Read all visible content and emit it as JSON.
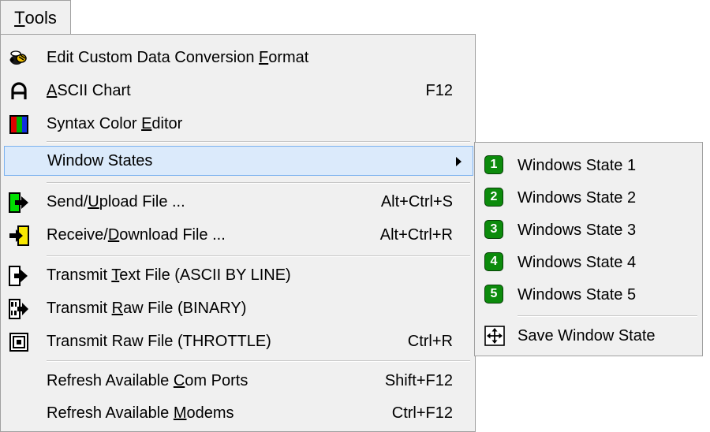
{
  "menu_bar": {
    "tools_label_underlined": "T",
    "tools_label_rest": "ools"
  },
  "colors": {
    "highlight_bg": "#dbeafb",
    "highlight_border": "#7cb2ef",
    "badge_green": "#0c8b0c"
  },
  "main_menu": {
    "edit_format": {
      "pre": "Edit Custom Data Conversion ",
      "ul": "F",
      "post": "ormat",
      "icon": "wasp-icon"
    },
    "ascii_chart": {
      "pre": "",
      "ul": "A",
      "post": "SCII Chart",
      "shortcut": "F12",
      "icon": "letter-a-icon"
    },
    "syntax_color": {
      "pre": "Syntax Color ",
      "ul": "E",
      "post": "ditor",
      "icon": "color-bars-icon"
    },
    "window_states": {
      "label": "Window States"
    },
    "send_upload": {
      "pre": "Send/",
      "ul": "U",
      "post": "pload File ...",
      "shortcut": "Alt+Ctrl+S",
      "icon": "send-file-icon"
    },
    "receive_download": {
      "pre": "Receive/",
      "ul": "D",
      "post": "ownload File ...",
      "shortcut": "Alt+Ctrl+R",
      "icon": "receive-file-icon"
    },
    "transmit_text": {
      "pre": "Transmit ",
      "ul": "T",
      "post": "ext File (ASCII BY LINE)",
      "icon": "transmit-text-icon"
    },
    "transmit_raw_binary": {
      "pre": "Transmit ",
      "ul": "R",
      "post": "aw File (BINARY)",
      "icon": "transmit-binary-icon"
    },
    "transmit_raw_throttle": {
      "pre": "Transmit Raw File (THROTTLE)",
      "shortcut": "Ctrl+R",
      "icon": "throttle-icon"
    },
    "refresh_com": {
      "pre": "Refresh Available ",
      "ul": "C",
      "post": "om Ports",
      "shortcut": "Shift+F12"
    },
    "refresh_modems": {
      "pre": "Refresh Available ",
      "ul": "M",
      "post": "odems",
      "shortcut": "Ctrl+F12"
    }
  },
  "sub_menu": {
    "states": [
      {
        "num": "1",
        "label": "Windows State 1"
      },
      {
        "num": "2",
        "label": "Windows State 2"
      },
      {
        "num": "3",
        "label": "Windows State 3"
      },
      {
        "num": "4",
        "label": "Windows State 4"
      },
      {
        "num": "5",
        "label": "Windows State 5"
      }
    ],
    "save": {
      "label": "Save Window State",
      "icon": "move-arrows-icon"
    }
  }
}
